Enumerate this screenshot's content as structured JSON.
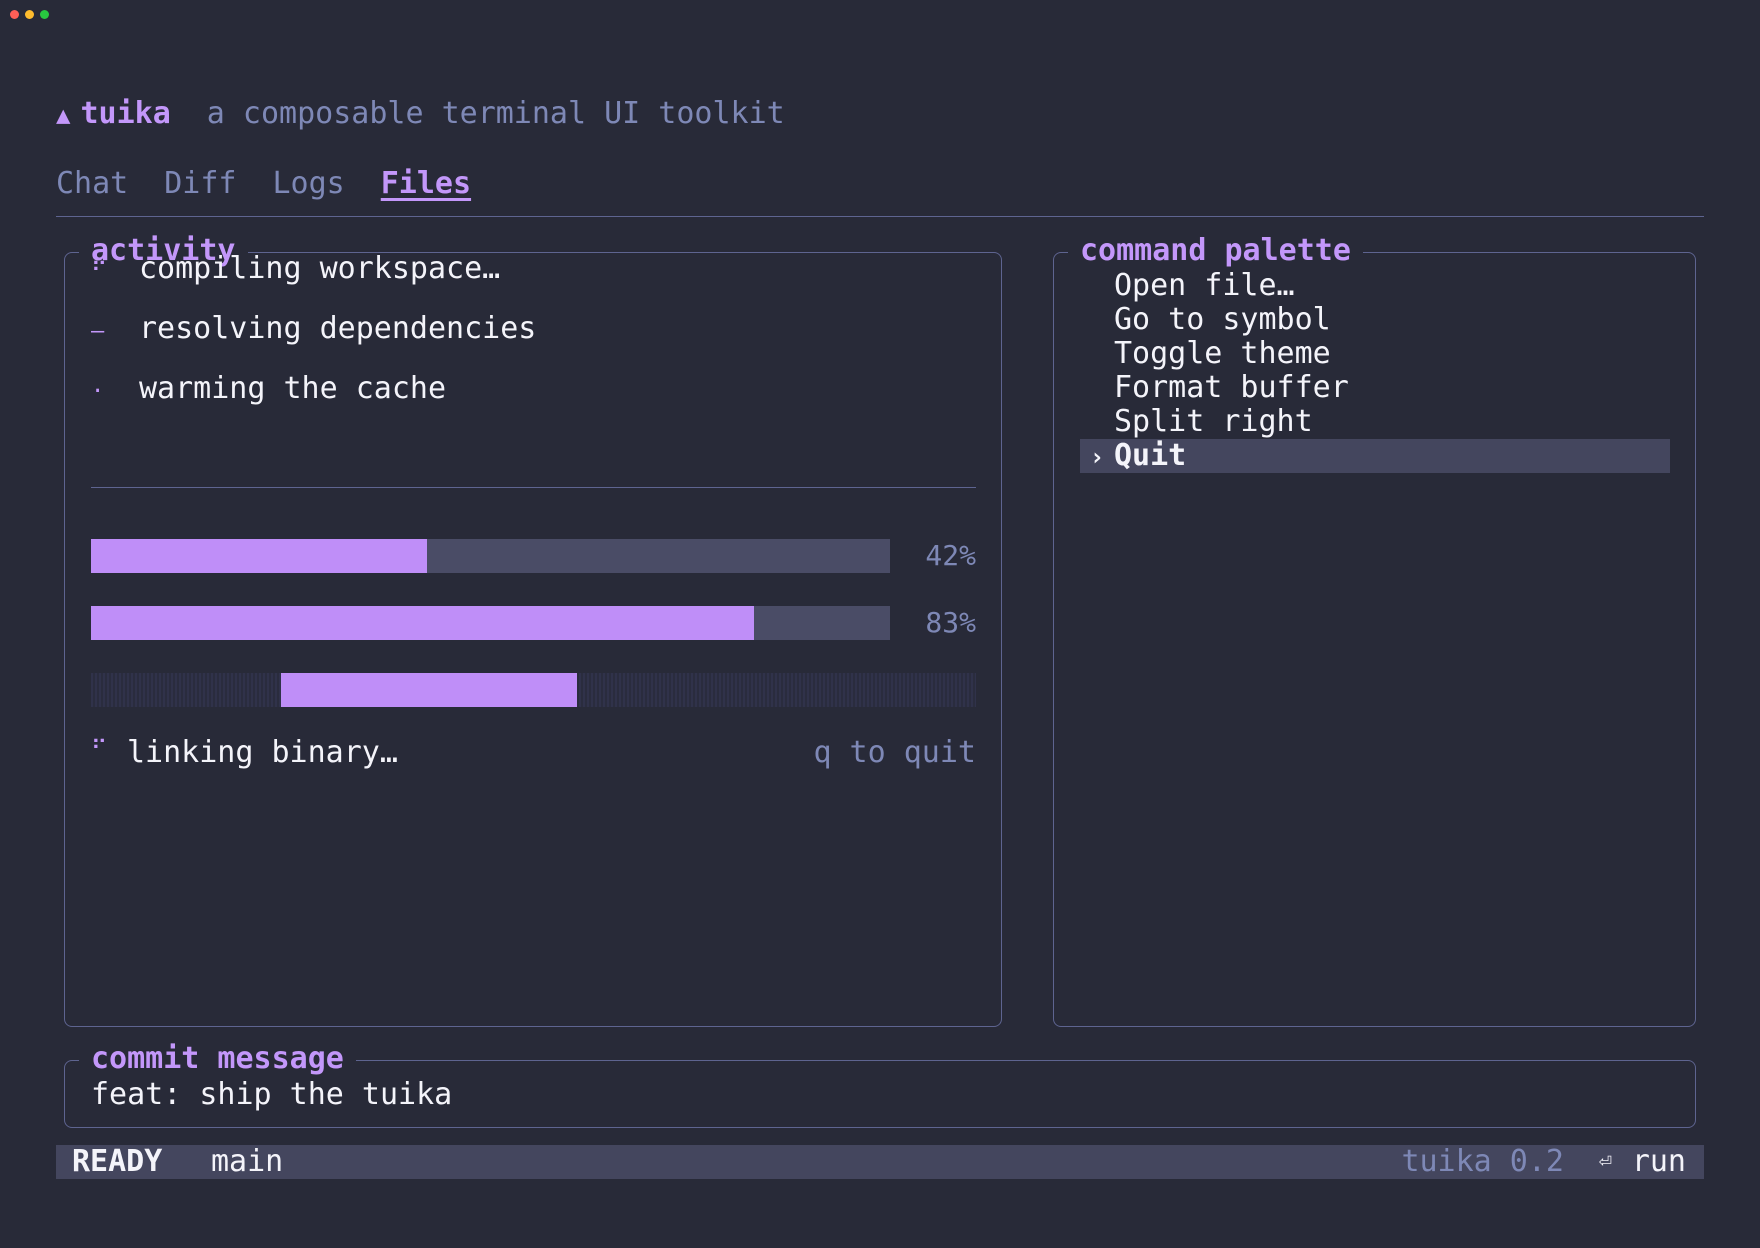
{
  "header": {
    "logo": "▲",
    "app_name": "tuika",
    "tagline": "a composable terminal UI toolkit"
  },
  "tabs": [
    {
      "label": "Chat",
      "active": false
    },
    {
      "label": "Diff",
      "active": false
    },
    {
      "label": "Logs",
      "active": false
    },
    {
      "label": "Files",
      "active": true
    }
  ],
  "activity": {
    "title": "activity",
    "tasks": [
      {
        "spinner": "⠋",
        "label": "compiling workspace…"
      },
      {
        "spinner": "—",
        "label": "resolving dependencies"
      },
      {
        "spinner": "·",
        "label": "warming the cache"
      }
    ],
    "progress": [
      {
        "value": 0.42,
        "label": "42%"
      },
      {
        "value": 0.83,
        "label": "83%"
      }
    ],
    "indeterminate": true,
    "status": {
      "spinner": "⠋",
      "label": "linking binary…",
      "hint": "q to quit"
    }
  },
  "palette": {
    "title": "command palette",
    "items": [
      "Open file…",
      "Go to symbol",
      "Toggle theme",
      "Format buffer",
      "Split right",
      "Quit"
    ],
    "selected_caret": "›",
    "selected_index": 5
  },
  "commit": {
    "title": "commit message",
    "value": "feat: ship the tuika"
  },
  "statusbar": {
    "mode": "READY",
    "branch": "main",
    "version": "tuika 0.2",
    "enter_icon": "⏎",
    "action": "run"
  },
  "colors": {
    "accent": "#c397fa",
    "muted": "#7e88b6",
    "background": "#282a38",
    "border": "#5e6490"
  }
}
